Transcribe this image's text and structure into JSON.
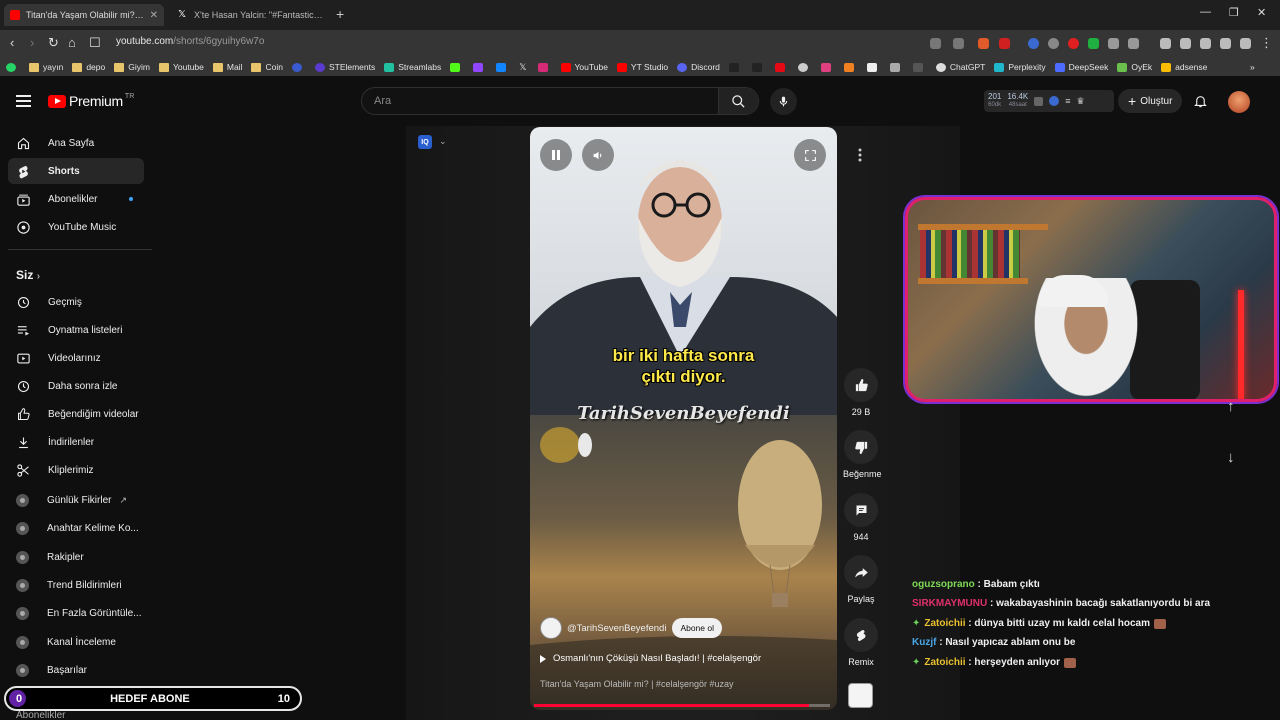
{
  "browser": {
    "tabs": [
      {
        "title": "Titan'da Yaşam Olabilir mi? | #",
        "active": true
      },
      {
        "title": "X'te Hasan Yalcin: \"#FantasticFour M",
        "active": false
      }
    ],
    "url": {
      "host": "youtube.com",
      "path": "/shorts/6gyuihy6w7o"
    }
  },
  "bookmarks": [
    "yayın",
    "depo",
    "Giyim",
    "Youtube",
    "Mail",
    "Coin",
    "STElements",
    "Streamlabs",
    "YouTube",
    "YT Studio",
    "Discord",
    "ChatGPT",
    "Perplexity",
    "DeepSeek",
    "OyEk",
    "adsense"
  ],
  "header": {
    "logo": "Premium",
    "region": "TR",
    "search_placeholder": "Ara",
    "stats": [
      {
        "value": "201",
        "label": "60dk"
      },
      {
        "value": "16.4K",
        "label": "48saat"
      }
    ],
    "create_label": "Oluştur"
  },
  "sidebar": {
    "main": [
      {
        "label": "Ana Sayfa",
        "icon": "home-icon"
      },
      {
        "label": "Shorts",
        "icon": "shorts-icon",
        "active": true
      },
      {
        "label": "Abonelikler",
        "icon": "subscriptions-icon"
      },
      {
        "label": "YouTube Music",
        "icon": "music-icon"
      }
    ],
    "you_heading": "Siz",
    "you": [
      {
        "label": "Geçmiş",
        "icon": "history-icon"
      },
      {
        "label": "Oynatma listeleri",
        "icon": "playlist-icon"
      },
      {
        "label": "Videolarınız",
        "icon": "your-videos-icon"
      },
      {
        "label": "Daha sonra izle",
        "icon": "watch-later-icon"
      },
      {
        "label": "Beğendiğim videolar",
        "icon": "like-icon"
      },
      {
        "label": "İndirilenler",
        "icon": "download-icon"
      },
      {
        "label": "Kliplerimiz",
        "icon": "clip-icon"
      }
    ],
    "tools": [
      {
        "label": "Günlük Fikirler",
        "external": true
      },
      {
        "label": "Anahtar Kelime Ko..."
      },
      {
        "label": "Rakipler"
      },
      {
        "label": "Trend Bildirimleri"
      },
      {
        "label": "En Fazla Görüntüle..."
      },
      {
        "label": "Kanal İnceleme"
      },
      {
        "label": "Başarılar"
      }
    ],
    "bottom_label": "Abonelikler"
  },
  "short": {
    "iq_badge": "IQ",
    "caption_line1": "bir iki hafta sonra",
    "caption_line2": "çıktı diyor.",
    "watermark": "TarihSevenBeyefendi",
    "channel": "@TarihSevenBeyefendi",
    "subscribe_label": "Abone ol",
    "linked_title": "Osmanlı'nın Çöküşü Nasıl Başladı! | #celalşengör",
    "description": "Titan'da Yaşam Olabilir mi? | #celalşengör #uzay",
    "progress_percent": 93
  },
  "actions": {
    "like_count": "29 B",
    "dislike_label": "Beğenme",
    "comment_count": "944",
    "share_label": "Paylaş",
    "remix_label": "Remix"
  },
  "chat": [
    {
      "user": "oguzsoprano",
      "color": "#7ed957",
      "badge": false,
      "message": " : Babam çıktı",
      "emoji": false
    },
    {
      "user": "SIRKMAYMUNU",
      "color": "#e0306a",
      "badge": false,
      "message": " : wakabayashinin bacağı sakatlanıyordu bi ara",
      "emoji": false
    },
    {
      "user": "Zatoichii",
      "color": "#e8c030",
      "badge": true,
      "message": " : dünya bitti uzay mı kaldı celal hocam",
      "emoji": true
    },
    {
      "user": "Kuzjf",
      "color": "#4aa8e8",
      "badge": false,
      "message": " : Nasıl yapıcaz ablam onu be",
      "emoji": false
    },
    {
      "user": "Zatoichii",
      "color": "#e8c030",
      "badge": true,
      "message": " : herşeyden anlıyor",
      "emoji": true
    }
  ],
  "goal": {
    "current": "0",
    "label": "HEDEF ABONE",
    "target": "10"
  }
}
